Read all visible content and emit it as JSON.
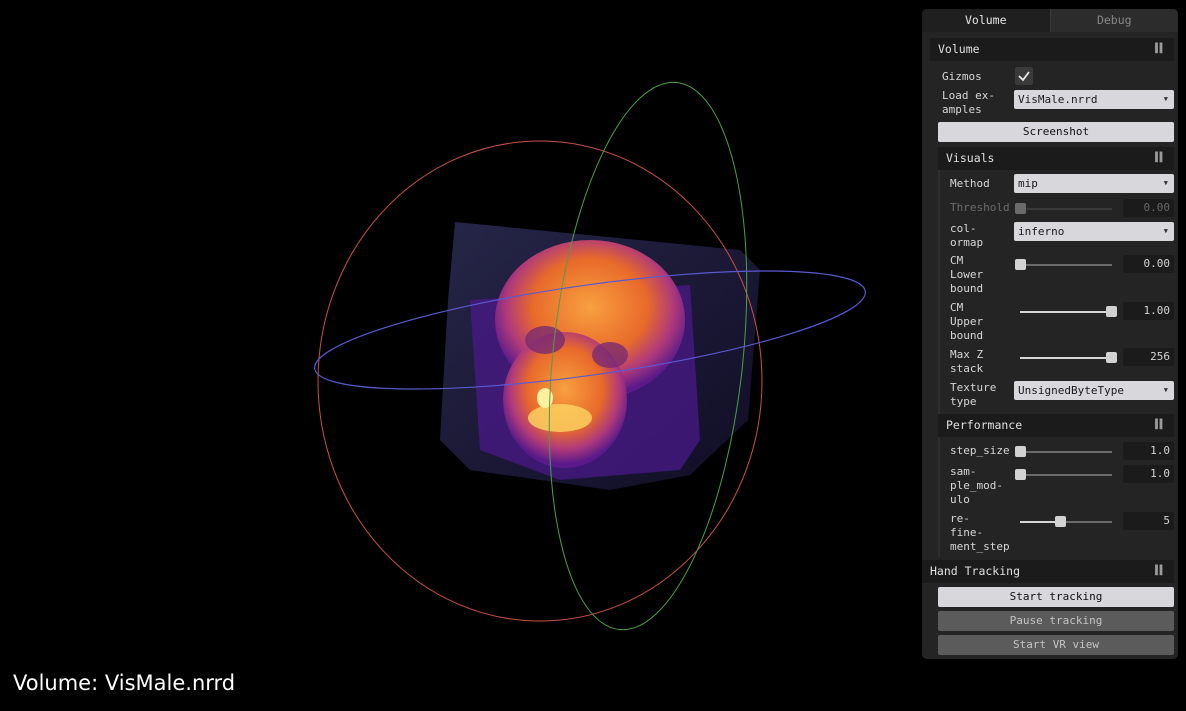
{
  "caption": "Volume: VisMale.nrrd",
  "tabs": [
    "Volume",
    "Debug"
  ],
  "volume": {
    "title": "Volume",
    "gizmos_label": "Gizmos",
    "gizmos_checked": true,
    "load_label": "Load ex-\namples",
    "load_value": "VisMale.nrrd",
    "screenshot_label": "Screenshot"
  },
  "visuals": {
    "title": "Visuals",
    "method_label": "Method",
    "method_value": "mip",
    "threshold_label": "Threshold",
    "threshold_value": "0.00",
    "colormap_label": "col-\normap",
    "colormap_value": "inferno",
    "cm_lower_label": "CM\nLower\nbound",
    "cm_lower_value": "0.00",
    "cm_upper_label": "CM\nUpper\nbound",
    "cm_upper_value": "1.00",
    "max_z_label": "Max Z\nstack",
    "max_z_value": "256",
    "texture_label": "Texture\ntype",
    "texture_value": "UnsignedByteType"
  },
  "performance": {
    "title": "Performance",
    "step_size_label": "step_size",
    "step_size_value": "1.0",
    "sample_modulo_label": "sam-\nple_mod-\nulo",
    "sample_modulo_value": "1.0",
    "refinement_label": "re-\nfine-\nment_step",
    "refinement_value": "5"
  },
  "hand_tracking": {
    "title": "Hand Tracking",
    "start_label": "Start tracking",
    "pause_label": "Pause tracking",
    "vr_label": "Start VR view"
  },
  "slider_levels": {
    "threshold": 0.0,
    "cm_lower": 0.0,
    "cm_upper": 1.0,
    "max_z": 1.0,
    "step_size": 0.0,
    "sample_modulo": 0.0,
    "refinement": 0.45
  },
  "colors": {
    "gizmo_x": "#c8504a",
    "gizmo_y": "#4aa04a",
    "gizmo_z": "#5a5ad0",
    "skull_core": "#f07a2a",
    "volume_bg": "#3a1a6a"
  }
}
